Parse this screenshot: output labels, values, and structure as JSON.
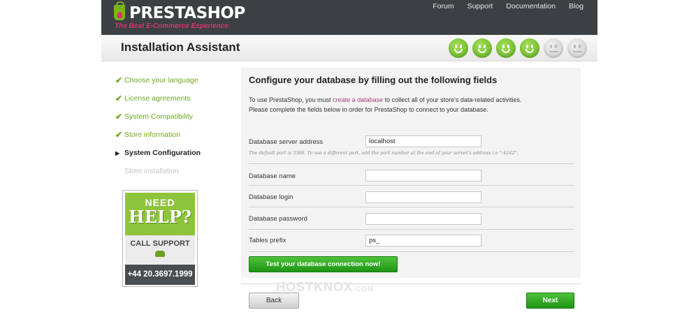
{
  "header": {
    "logo_text_1": "PRESTA",
    "logo_text_2": "SHOP",
    "tagline": "The Best E-Commerce Experience",
    "nav": [
      "Forum",
      "Support",
      "Documentation",
      "Blog"
    ]
  },
  "title": "Installation Assistant",
  "progress": {
    "completed_steps": 4,
    "total_steps": 6
  },
  "steps": [
    {
      "label": "Choose your language",
      "state": "done"
    },
    {
      "label": "License agreements",
      "state": "done"
    },
    {
      "label": "System Compatibility",
      "state": "done"
    },
    {
      "label": "Store information",
      "state": "done"
    },
    {
      "label": "System Configuration",
      "state": "current"
    },
    {
      "label": "Store installation",
      "state": "todo"
    }
  ],
  "help_box": {
    "need": "NEED",
    "help": "HELP?",
    "call": "CALL SUPPORT",
    "phone": "+44 20.3697.1999"
  },
  "form": {
    "heading": "Configure your database by filling out the following fields",
    "intro_before_link": "To use PrestaShop, you must ",
    "intro_link": "create a database",
    "intro_after_link": " to collect all of your store's data-related activities.",
    "intro_line2": "Please complete the fields below in order for PrestaShop to connect to your database.",
    "fields": {
      "server": {
        "label": "Database server address",
        "value": "localhost",
        "hint": "The default port is 3306. To use a different port, add the port number at the end of your server's address i.e \":4242\"."
      },
      "name": {
        "label": "Database name",
        "value": ""
      },
      "login": {
        "label": "Database login",
        "value": ""
      },
      "password": {
        "label": "Database password",
        "value": ""
      },
      "prefix": {
        "label": "Tables prefix",
        "value": "ps_"
      }
    },
    "test_button": "Test your database connection now!"
  },
  "watermark": "HOSTKNOX",
  "watermark_suffix": ".COM",
  "buttons": {
    "back": "Back",
    "next": "Next"
  },
  "colors": {
    "accent_green": "#6fa820",
    "header_dark": "#3d4043",
    "link_pink": "#a6427a"
  }
}
